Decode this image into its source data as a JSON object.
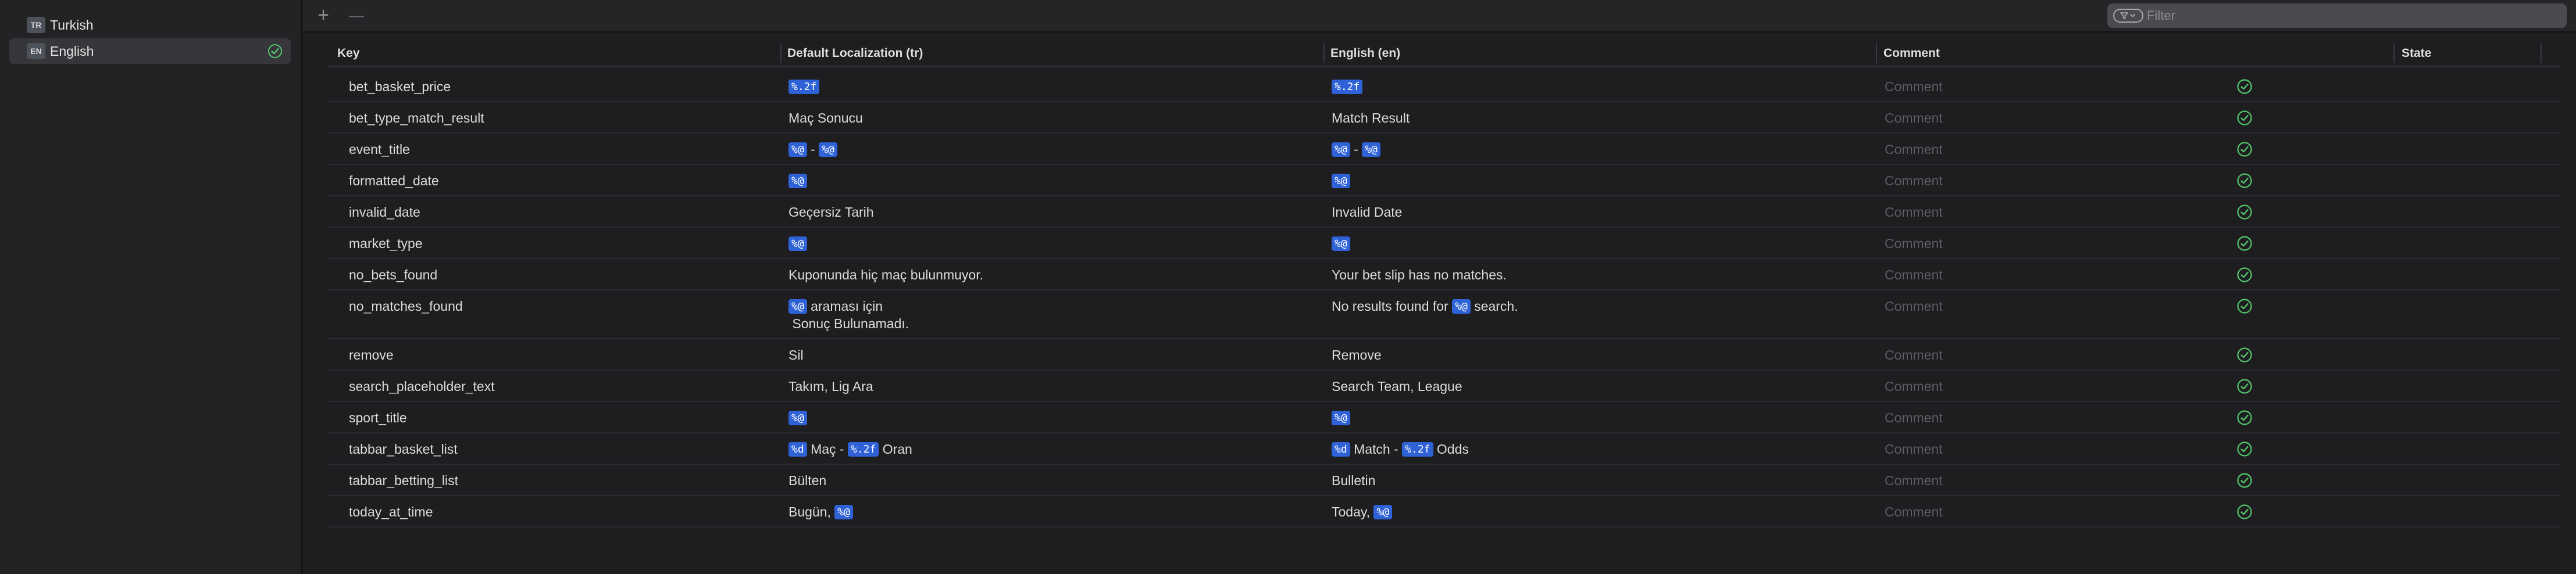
{
  "colors": {
    "accent": "#2f62d6",
    "check": "#53c86b",
    "background": "#1e1e21",
    "sidebar": "#232326"
  },
  "sidebar": {
    "languages": [
      {
        "code": "TR",
        "name": "Turkish",
        "selected": false,
        "done": false
      },
      {
        "code": "EN",
        "name": "English",
        "selected": true,
        "done": true
      }
    ]
  },
  "toolbar": {
    "add_label": "+",
    "remove_label": "—",
    "filter_placeholder": "Filter",
    "filter_icon": "filter-menu-icon"
  },
  "table": {
    "headers": {
      "key": "Key",
      "default": "Default Localization (tr)",
      "english": "English (en)",
      "comment": "Comment",
      "state": "State"
    },
    "comment_placeholder": "Comment",
    "state_icon": "checkmark-circle-icon",
    "rows": [
      {
        "key": "bet_basket_price",
        "tr": [
          [
            {
              "t": "tok",
              "v": "%.2f"
            }
          ]
        ],
        "en": [
          [
            {
              "t": "tok",
              "v": "%.2f"
            }
          ]
        ]
      },
      {
        "key": "bet_type_match_result",
        "tr": [
          [
            {
              "t": "txt",
              "v": "Maç Sonucu"
            }
          ]
        ],
        "en": [
          [
            {
              "t": "txt",
              "v": "Match Result"
            }
          ]
        ]
      },
      {
        "key": "event_title",
        "tr": [
          [
            {
              "t": "tok",
              "v": "%@"
            },
            {
              "t": "txt",
              "v": " - "
            },
            {
              "t": "tok",
              "v": "%@"
            }
          ]
        ],
        "en": [
          [
            {
              "t": "tok",
              "v": "%@"
            },
            {
              "t": "txt",
              "v": " - "
            },
            {
              "t": "tok",
              "v": "%@"
            }
          ]
        ]
      },
      {
        "key": "formatted_date",
        "tr": [
          [
            {
              "t": "tok",
              "v": "%@"
            }
          ]
        ],
        "en": [
          [
            {
              "t": "tok",
              "v": "%@"
            }
          ]
        ]
      },
      {
        "key": "invalid_date",
        "tr": [
          [
            {
              "t": "txt",
              "v": "Geçersiz Tarih"
            }
          ]
        ],
        "en": [
          [
            {
              "t": "txt",
              "v": "Invalid Date"
            }
          ]
        ]
      },
      {
        "key": "market_type",
        "tr": [
          [
            {
              "t": "tok",
              "v": "%@"
            }
          ]
        ],
        "en": [
          [
            {
              "t": "tok",
              "v": "%@"
            }
          ]
        ]
      },
      {
        "key": "no_bets_found",
        "tr": [
          [
            {
              "t": "txt",
              "v": "Kuponunda hiç maç bulunmuyor."
            }
          ]
        ],
        "en": [
          [
            {
              "t": "txt",
              "v": "Your bet slip has no matches."
            }
          ]
        ]
      },
      {
        "key": "no_matches_found",
        "tr": [
          [
            {
              "t": "tok",
              "v": "%@"
            },
            {
              "t": "txt",
              "v": " araması için"
            }
          ],
          [
            {
              "t": "txt",
              "v": " Sonuç Bulunamadı."
            }
          ]
        ],
        "en": [
          [
            {
              "t": "txt",
              "v": "No results found for "
            },
            {
              "t": "tok",
              "v": "%@"
            },
            {
              "t": "txt",
              "v": " search."
            }
          ]
        ]
      },
      {
        "key": "remove",
        "tr": [
          [
            {
              "t": "txt",
              "v": "Sil"
            }
          ]
        ],
        "en": [
          [
            {
              "t": "txt",
              "v": "Remove"
            }
          ]
        ]
      },
      {
        "key": "search_placeholder_text",
        "tr": [
          [
            {
              "t": "txt",
              "v": "Takım, Lig Ara"
            }
          ]
        ],
        "en": [
          [
            {
              "t": "txt",
              "v": "Search Team, League"
            }
          ]
        ]
      },
      {
        "key": "sport_title",
        "tr": [
          [
            {
              "t": "tok",
              "v": "%@"
            }
          ]
        ],
        "en": [
          [
            {
              "t": "tok",
              "v": "%@"
            }
          ]
        ]
      },
      {
        "key": "tabbar_basket_list",
        "tr": [
          [
            {
              "t": "tok",
              "v": "%d"
            },
            {
              "t": "txt",
              "v": " Maç - "
            },
            {
              "t": "tok",
              "v": "%.2f"
            },
            {
              "t": "txt",
              "v": " Oran"
            }
          ]
        ],
        "en": [
          [
            {
              "t": "tok",
              "v": "%d"
            },
            {
              "t": "txt",
              "v": " Match - "
            },
            {
              "t": "tok",
              "v": "%.2f"
            },
            {
              "t": "txt",
              "v": " Odds"
            }
          ]
        ]
      },
      {
        "key": "tabbar_betting_list",
        "tr": [
          [
            {
              "t": "txt",
              "v": "Bülten"
            }
          ]
        ],
        "en": [
          [
            {
              "t": "txt",
              "v": "Bulletin"
            }
          ]
        ]
      },
      {
        "key": "today_at_time",
        "tr": [
          [
            {
              "t": "txt",
              "v": "Bugün, "
            },
            {
              "t": "tok",
              "v": "%@"
            }
          ]
        ],
        "en": [
          [
            {
              "t": "txt",
              "v": "Today, "
            },
            {
              "t": "tok",
              "v": "%@"
            }
          ]
        ]
      }
    ]
  }
}
